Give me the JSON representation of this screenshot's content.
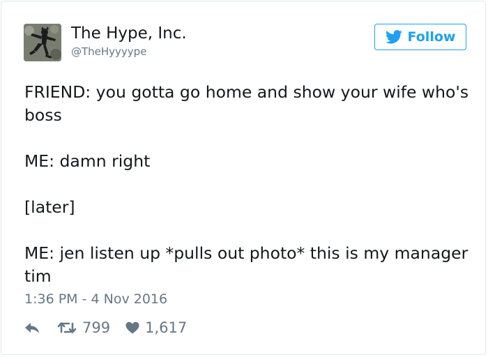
{
  "author": {
    "name": "The Hype, Inc.",
    "handle": "@TheHyyyype"
  },
  "follow_button": {
    "label": "Follow",
    "icon": "twitter-bird-icon"
  },
  "tweet": {
    "paragraphs": [
      "FRIEND: you gotta go home and show your wife who's boss",
      "ME: damn right",
      "[later]",
      "ME: jen listen up *pulls out photo* this is my manager tim"
    ],
    "timestamp": "1:36 PM - 4 Nov 2016"
  },
  "actions": {
    "reply_icon": "reply-icon",
    "retweet_icon": "retweet-icon",
    "retweet_count": "799",
    "like_icon": "heart-icon",
    "like_count": "1,617"
  },
  "colors": {
    "accent": "#1da1f2",
    "secondary_text": "#657786",
    "text": "#14171a",
    "border": "#e1e8ed"
  }
}
